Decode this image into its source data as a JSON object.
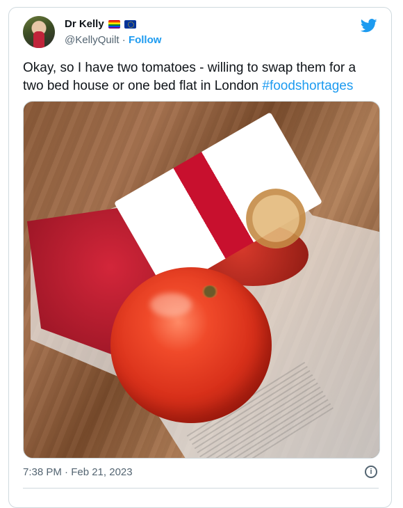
{
  "author": {
    "display_name": "Dr Kelly",
    "handle": "@KellyQuilt",
    "separator": "·",
    "follow_label": "Follow",
    "flags": [
      "rainbow-flag-icon",
      "eu-flag-icon"
    ]
  },
  "tweet": {
    "text": "Okay, so I have two tomatoes - willing to swap them for a two bed house or one bed flat in London ",
    "hashtag": "#foodshortages",
    "timestamp": "7:38 PM · Feb 21, 2023"
  },
  "icons": {
    "brand": "twitter-bird-icon",
    "info": "info-icon"
  },
  "colors": {
    "accent": "#1d9bf0",
    "text": "#0f1419",
    "muted": "#536471",
    "border": "#cfd9de"
  }
}
